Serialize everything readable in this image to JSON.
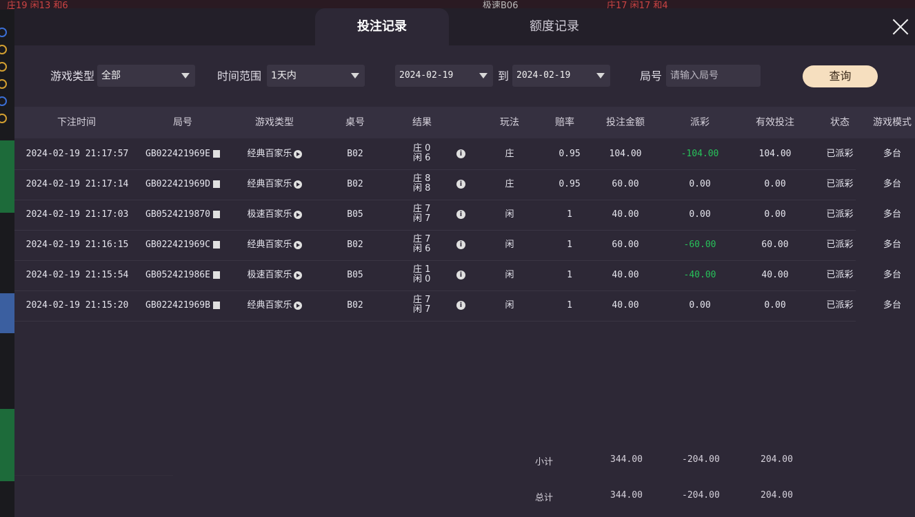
{
  "tabs": [
    {
      "label": "投注记录",
      "active": true
    },
    {
      "label": "额度记录",
      "active": false
    }
  ],
  "filters": {
    "game_type_label": "游戏类型",
    "game_type_value": "全部",
    "time_range_label": "时间范围",
    "time_range_value": "1天内",
    "date_from": "2024-02-19",
    "to_label": "到",
    "date_to": "2024-02-19",
    "round_label": "局号",
    "round_placeholder": "请输入局号",
    "query_label": "查询"
  },
  "columns": [
    "下注时间",
    "局号",
    "游戏类型",
    "桌号",
    "结果",
    "玩法",
    "赔率",
    "投注金额",
    "派彩",
    "有效投注",
    "状态",
    "游戏模式"
  ],
  "rows": [
    {
      "time": "2024-02-19 21:17:57",
      "round": "GB022421969E",
      "game": "经典百家乐",
      "table": "B02",
      "banker": "庄 0",
      "player": "闲 6",
      "bet": "庄",
      "odds": "0.95",
      "amount": "104.00",
      "payout": "-104.00",
      "payout_negative": true,
      "valid": "104.00",
      "status": "已派彩",
      "mode": "多台"
    },
    {
      "time": "2024-02-19 21:17:14",
      "round": "GB022421969D",
      "game": "经典百家乐",
      "table": "B02",
      "banker": "庄 8",
      "player": "闲 8",
      "bet": "庄",
      "odds": "0.95",
      "amount": "60.00",
      "payout": "0.00",
      "payout_negative": false,
      "valid": "0.00",
      "status": "已派彩",
      "mode": "多台"
    },
    {
      "time": "2024-02-19 21:17:03",
      "round": "GB0524219870",
      "game": "极速百家乐",
      "table": "B05",
      "banker": "庄 7",
      "player": "闲 7",
      "bet": "闲",
      "odds": "1",
      "amount": "40.00",
      "payout": "0.00",
      "payout_negative": false,
      "valid": "0.00",
      "status": "已派彩",
      "mode": "多台"
    },
    {
      "time": "2024-02-19 21:16:15",
      "round": "GB022421969C",
      "game": "经典百家乐",
      "table": "B02",
      "banker": "庄 7",
      "player": "闲 6",
      "bet": "闲",
      "odds": "1",
      "amount": "60.00",
      "payout": "-60.00",
      "payout_negative": true,
      "valid": "60.00",
      "status": "已派彩",
      "mode": "多台"
    },
    {
      "time": "2024-02-19 21:15:54",
      "round": "GB052421986E",
      "game": "极速百家乐",
      "table": "B05",
      "banker": "庄 1",
      "player": "闲 0",
      "bet": "闲",
      "odds": "1",
      "amount": "40.00",
      "payout": "-40.00",
      "payout_negative": true,
      "valid": "40.00",
      "status": "已派彩",
      "mode": "多台"
    },
    {
      "time": "2024-02-19 21:15:20",
      "round": "GB022421969B",
      "game": "经典百家乐",
      "table": "B02",
      "banker": "庄 7",
      "player": "闲 7",
      "bet": "闲",
      "odds": "1",
      "amount": "40.00",
      "payout": "0.00",
      "payout_negative": false,
      "valid": "0.00",
      "status": "已派彩",
      "mode": "多台"
    }
  ],
  "subtotal": {
    "label": "小计",
    "amount": "344.00",
    "payout": "-204.00",
    "valid": "204.00"
  },
  "total": {
    "label": "总计",
    "amount": "344.00",
    "payout": "-204.00",
    "valid": "204.00"
  },
  "background": {
    "top_text_1": "庄19 闲13 和6",
    "top_text_2": "极速B06",
    "top_text_3": "庄17 闲17 和4"
  },
  "colors": {
    "accent_button": "#f6dfbf",
    "negative_payout": "#27c25a",
    "panel": "#2d2836",
    "header_row": "#353040"
  }
}
